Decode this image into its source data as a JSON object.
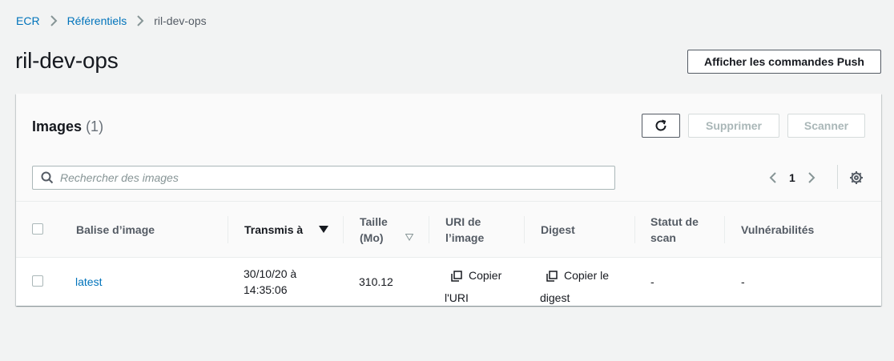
{
  "breadcrumb": {
    "items": [
      "ECR",
      "Référentiels"
    ],
    "current": "ril-dev-ops"
  },
  "page": {
    "title": "ril-dev-ops",
    "push_button": "Afficher les commandes Push"
  },
  "panel": {
    "title": "Images",
    "count": "(1)",
    "delete_button": "Supprimer",
    "scan_button": "Scanner",
    "search_placeholder": "Rechercher des images",
    "page_number": "1"
  },
  "table": {
    "headers": {
      "tag": "Balise d’image",
      "pushed": "Transmis à",
      "size_line1": "Taille",
      "size_line2": "(Mo)",
      "uri_line1": "URI de",
      "uri_line2": "l’image",
      "digest": "Digest",
      "scan_line1": "Statut de",
      "scan_line2": "scan",
      "vuln": "Vulnérabilités"
    },
    "rows": [
      {
        "tag": "latest",
        "pushed_line1": "30/10/20 à",
        "pushed_line2": "14:35:06",
        "size": "310.12",
        "uri_line1": "Copier",
        "uri_line2": "l'URI",
        "digest_line1": "Copier le",
        "digest_line2": "digest",
        "scan_status": "-",
        "vulnerabilities": "-"
      }
    ]
  },
  "colors": {
    "link": "#0073bb",
    "background": "#f2f3f3",
    "text": "#16191f"
  },
  "icons": [
    "chevron-right-icon",
    "refresh-icon",
    "search-icon",
    "chevron-left-icon",
    "gear-icon",
    "sort-desc-icon",
    "sort-icon",
    "copy-icon"
  ]
}
